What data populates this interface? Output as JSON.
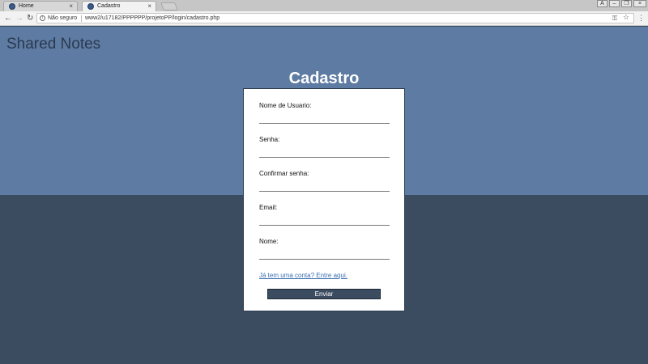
{
  "browser": {
    "tabs": [
      {
        "title": "Home",
        "active": false
      },
      {
        "title": "Cadastro",
        "active": true
      }
    ],
    "security_label": "Não seguro",
    "url": "www2/u17182/PPPPPP/projetoPP/login/cadastro.php"
  },
  "page": {
    "brand": "Shared Notes",
    "title": "Cadastro",
    "fields": [
      {
        "label": "Nome de Usuario:",
        "value": ""
      },
      {
        "label": "Senha:",
        "value": ""
      },
      {
        "label": "Confirmar senha:",
        "value": ""
      },
      {
        "label": "Email:",
        "value": ""
      },
      {
        "label": "Nome:",
        "value": ""
      }
    ],
    "login_link": "Já tem uma conta? Entre aqui.",
    "submit_label": "Enviar"
  },
  "colors": {
    "header_blue": "#5e7ba3",
    "dark_slate": "#3b4b60",
    "card_bg": "#ffffff",
    "link": "#3b6fb2"
  }
}
